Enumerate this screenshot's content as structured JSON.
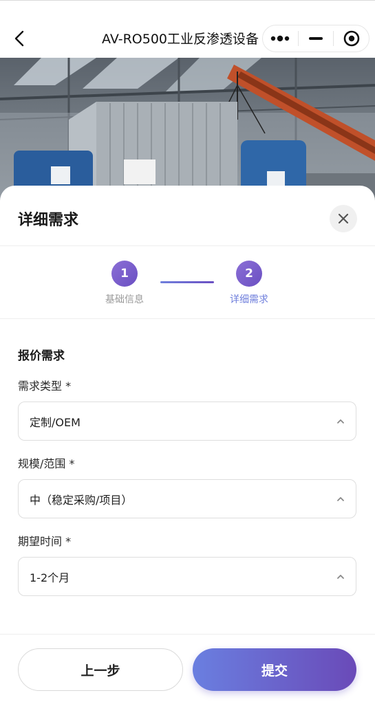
{
  "navbar": {
    "title": "AV-RO500工业反渗透设备"
  },
  "sheet": {
    "title": "详细需求"
  },
  "stepper": {
    "steps": [
      {
        "number": "1",
        "label": "基础信息"
      },
      {
        "number": "2",
        "label": "详细需求"
      }
    ],
    "active_step": 2
  },
  "form": {
    "section_title": "报价需求",
    "fields": [
      {
        "label": "需求类型 *",
        "value": "定制/OEM"
      },
      {
        "label": "规模/范围 *",
        "value": "中（稳定采购/项目）"
      },
      {
        "label": "期望时间 *",
        "value": "1-2个月"
      }
    ]
  },
  "footer": {
    "prev_label": "上一步",
    "submit_label": "提交"
  },
  "colors": {
    "accent_start": "#6a7fe0",
    "accent_end": "#6a4ab8",
    "step_active_label": "#6f7fdc"
  },
  "icons": [
    "back-arrow-icon",
    "more-dots-icon",
    "minimize-icon",
    "record-icon",
    "close-icon",
    "chevron-up-icon"
  ]
}
